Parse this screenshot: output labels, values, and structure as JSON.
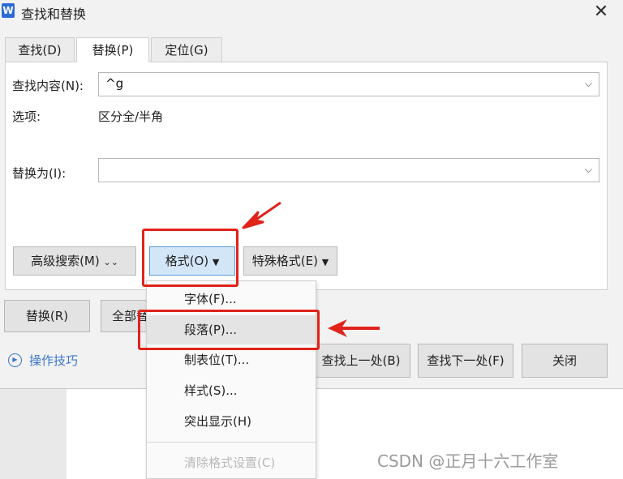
{
  "window": {
    "title": "查找和替换",
    "app_icon": "W",
    "close_glyph": "✕"
  },
  "tabs": [
    {
      "label": "查找(D)",
      "active": false
    },
    {
      "label": "替换(P)",
      "active": true
    },
    {
      "label": "定位(G)",
      "active": false
    }
  ],
  "find": {
    "label": "查找内容(N):",
    "value": "^g"
  },
  "options": {
    "label": "选项:",
    "value": "区分全/半角"
  },
  "replace": {
    "label": "替换为(I):",
    "value": ""
  },
  "buttons": {
    "advanced_search": "高级搜索(M)",
    "format": "格式(O)",
    "special_format": "特殊格式(E)",
    "replace": "替换(R)",
    "replace_all": "全部替换(A)",
    "find_prev": "查找上一处(B)",
    "find_next": "查找下一处(F)",
    "close": "关闭"
  },
  "format_menu": {
    "items": [
      {
        "label": "字体(F)...",
        "state": "normal"
      },
      {
        "label": "段落(P)...",
        "state": "hover"
      },
      {
        "label": "制表位(T)...",
        "state": "normal"
      },
      {
        "label": "样式(S)...",
        "state": "normal"
      },
      {
        "label": "突出显示(H)",
        "state": "normal"
      },
      {
        "label": "清除格式设置(C)",
        "state": "disabled"
      }
    ]
  },
  "tips": {
    "label": "操作技巧"
  },
  "glyphs": {
    "dropdown": "⌵",
    "triangle_down": "▼",
    "double_chevron": "⌄⌄"
  },
  "watermark": "CSDN @正月十六工作室",
  "colors": {
    "annotation_red": "#e0231b",
    "link_blue": "#3b77c9",
    "format_button_bg": "#d2e6f7"
  }
}
